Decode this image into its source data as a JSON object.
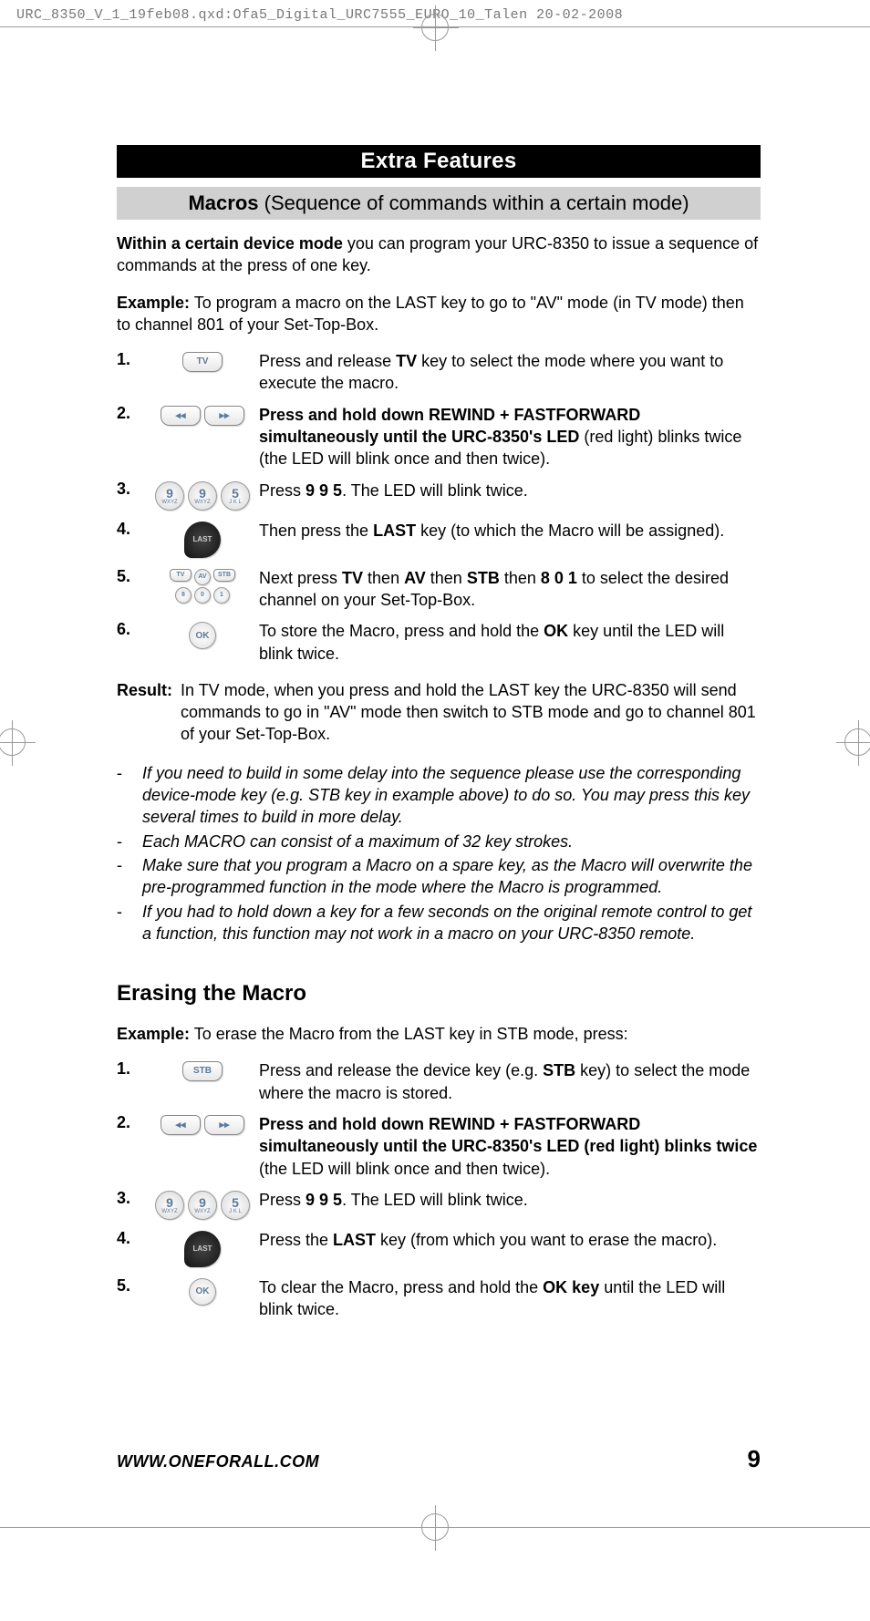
{
  "header_crop": "URC_8350_V_1_19feb08.qxd:Ofa5_Digital_URC7555_EURO_10_Talen  20-02-2008",
  "titlebar": "Extra Features",
  "subtitlebar_bold": "Macros",
  "subtitlebar_rest": " (Sequence of commands within a certain mode)",
  "intro_bold": "Within a certain device mode",
  "intro_rest": " you can program your URC-8350 to issue a sequence of commands at the press of one key.",
  "example_bold": "Example:",
  "example_rest": " To program a macro on the LAST key to go to \"AV\" mode (in TV mode) then to channel 801 of your Set-Top-Box.",
  "steps_macro": [
    {
      "num": "1.",
      "icon": "tv",
      "html": "Press and release <b>TV</b> key to select the mode where you want to execute the macro."
    },
    {
      "num": "2.",
      "icon": "rwff",
      "html": "<b>Press and hold down REWIND + FASTFORWARD simultaneously until the URC-8350's LED</b> (red light) blinks twice (the LED will blink once and then twice)."
    },
    {
      "num": "3.",
      "icon": "995",
      "html": "Press <b>9 9 5</b>. The LED will blink twice."
    },
    {
      "num": "4.",
      "icon": "last",
      "html": "Then press the <b>LAST</b> key (to which the Macro will be assigned)."
    },
    {
      "num": "5.",
      "icon": "stack",
      "html": "Next press <b>TV</b> then <b>AV</b> then <b>STB</b> then <b>8 0 1</b> to select the desired channel on your Set-Top-Box."
    },
    {
      "num": "6.",
      "icon": "ok",
      "html": "To store the Macro, press and hold the <b>OK</b> key until the LED will blink twice."
    }
  ],
  "result_bold": "Result:",
  "result_rest": "In TV mode, when you press and hold the LAST key the URC-8350 will send commands to go in \"AV\" mode then switch to STB mode and go to channel 801 of your Set-Top-Box.",
  "notes": [
    "If you need to build in some delay into the sequence please use the corresponding device-mode key (e.g. STB key in example above) to do so. You may press this key several times to build in more delay.",
    "Each MACRO can consist of a maximum of 32 key strokes.",
    "Make sure that you program a Macro on a spare key, as the Macro will overwrite the pre-programmed function in the mode where the Macro is programmed.",
    "If you had to hold down a key for a few seconds on the original remote control to get a function, this function may not work in a macro on your URC-8350 remote."
  ],
  "erase_heading": "Erasing the Macro",
  "erase_example_bold": "Example:",
  "erase_example_rest": " To erase the Macro from the LAST key in STB mode, press:",
  "steps_erase": [
    {
      "num": "1.",
      "icon": "stb",
      "html": "Press and release the device key (e.g. <b>STB</b> key) to select the mode where the macro is stored."
    },
    {
      "num": "2.",
      "icon": "rwff",
      "html": "<b>Press and hold down REWIND + FASTFORWARD simultaneously until the URC-8350's LED (red light) blinks twice</b> (the LED will blink once and then twice)."
    },
    {
      "num": "3.",
      "icon": "995",
      "html": "Press <b>9 9 5</b>. The LED will blink twice."
    },
    {
      "num": "4.",
      "icon": "last",
      "html": "Press the <b>LAST</b> key (from which you want to erase the macro)."
    },
    {
      "num": "5.",
      "icon": "ok",
      "html": "To clear the Macro, press and hold the <b>OK key</b> until the LED will blink twice."
    }
  ],
  "footer_url": "WWW.ONEFORALL.COM",
  "footer_page": "9",
  "key_labels": {
    "tv": "TV",
    "stb": "STB",
    "av": "AV",
    "ok": "OK",
    "last": "LAST",
    "n9": "9",
    "n9sub": "WXYZ",
    "n5": "5",
    "n5sub": "J K L",
    "n8": "8",
    "n0": "0",
    "n1": "1"
  }
}
